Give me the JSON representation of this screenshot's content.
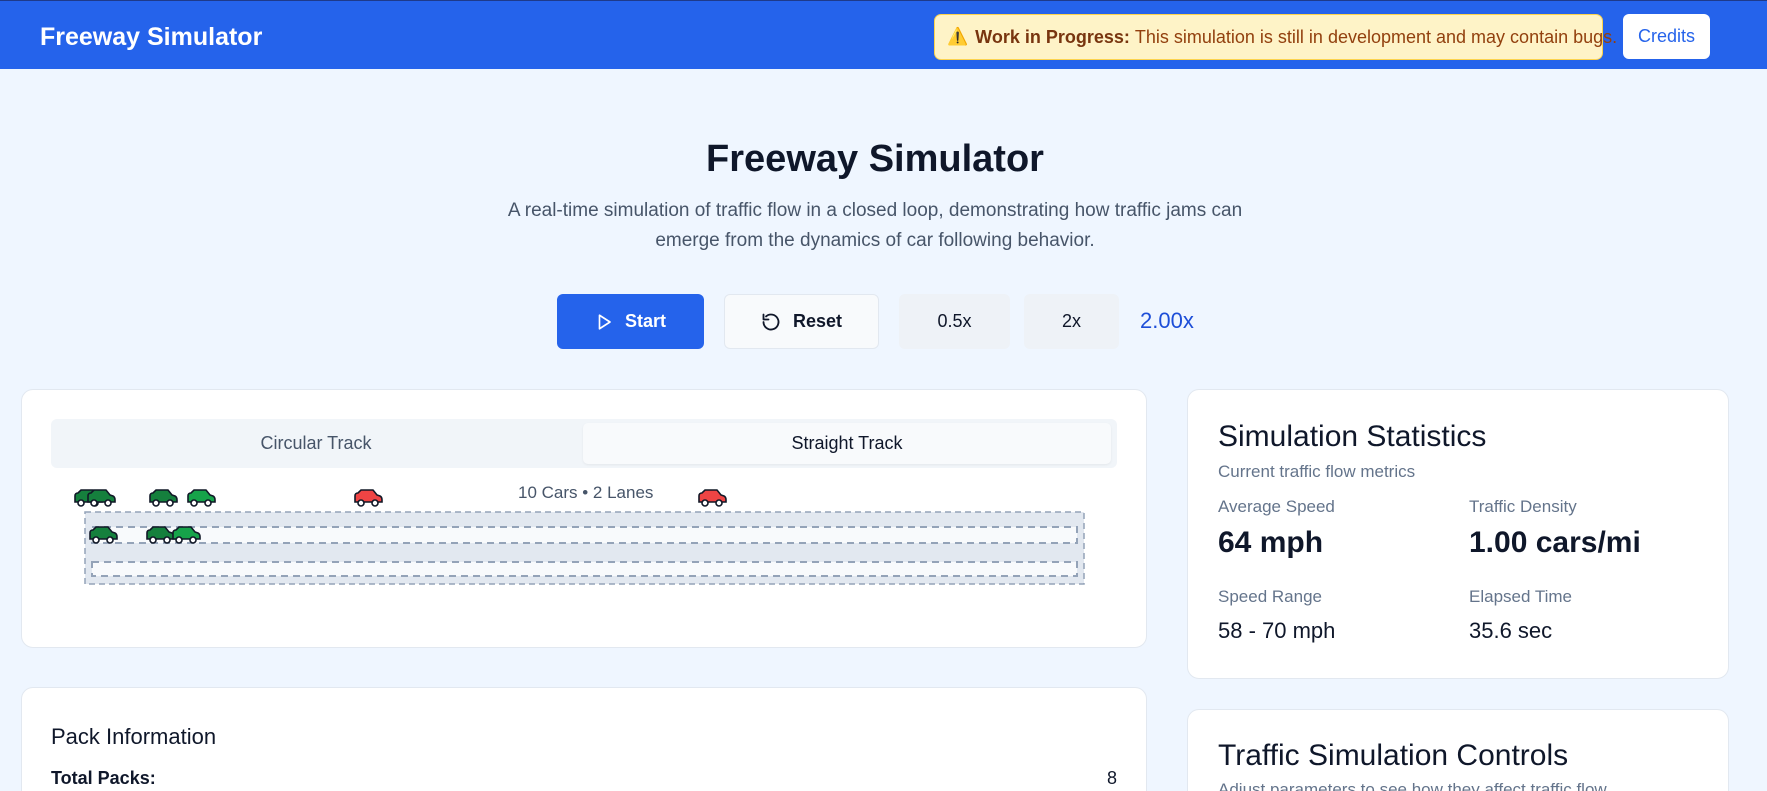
{
  "header": {
    "brand": "Freeway Simulator",
    "warning": {
      "icon": "warning-icon",
      "title": "Work in Progress:",
      "message": "This simulation is still in development and may contain bugs."
    },
    "credits_label": "Credits"
  },
  "hero": {
    "title": "Freeway Simulator",
    "description": "A real-time simulation of traffic flow in a closed loop, demonstrating how traffic jams can emerge from the dynamics of car following behavior."
  },
  "controls": {
    "start_label": "Start",
    "reset_label": "Reset",
    "slower_label": "0.5x",
    "faster_label": "2x",
    "speed_readout": "2.00x"
  },
  "track": {
    "tabs": [
      {
        "label": "Circular Track",
        "active": false
      },
      {
        "label": "Straight Track",
        "active": true
      }
    ],
    "caption": "10 Cars • 2 Lanes",
    "car_colors": {
      "fast": "#16a34a",
      "medium": "#15803d",
      "slow": "#ef4444"
    }
  },
  "stats": {
    "title": "Simulation Statistics",
    "subtitle": "Current traffic flow metrics",
    "average_speed_label": "Average Speed",
    "average_speed": "64 mph",
    "density_label": "Traffic Density",
    "density": "1.00 cars/mi",
    "range_label": "Speed Range",
    "range": "58 - 70 mph",
    "elapsed_label": "Elapsed Time",
    "elapsed": "35.6 sec"
  },
  "pack": {
    "title": "Pack Information",
    "total_label": "Total Packs:",
    "total_value": "8"
  },
  "traffic_controls": {
    "title": "Traffic Simulation Controls",
    "subtitle": "Adjust parameters to see how they affect traffic flow"
  },
  "colors": {
    "primary": "#2563eb",
    "warning_bg": "#fef3c7",
    "background": "#eff6ff"
  }
}
